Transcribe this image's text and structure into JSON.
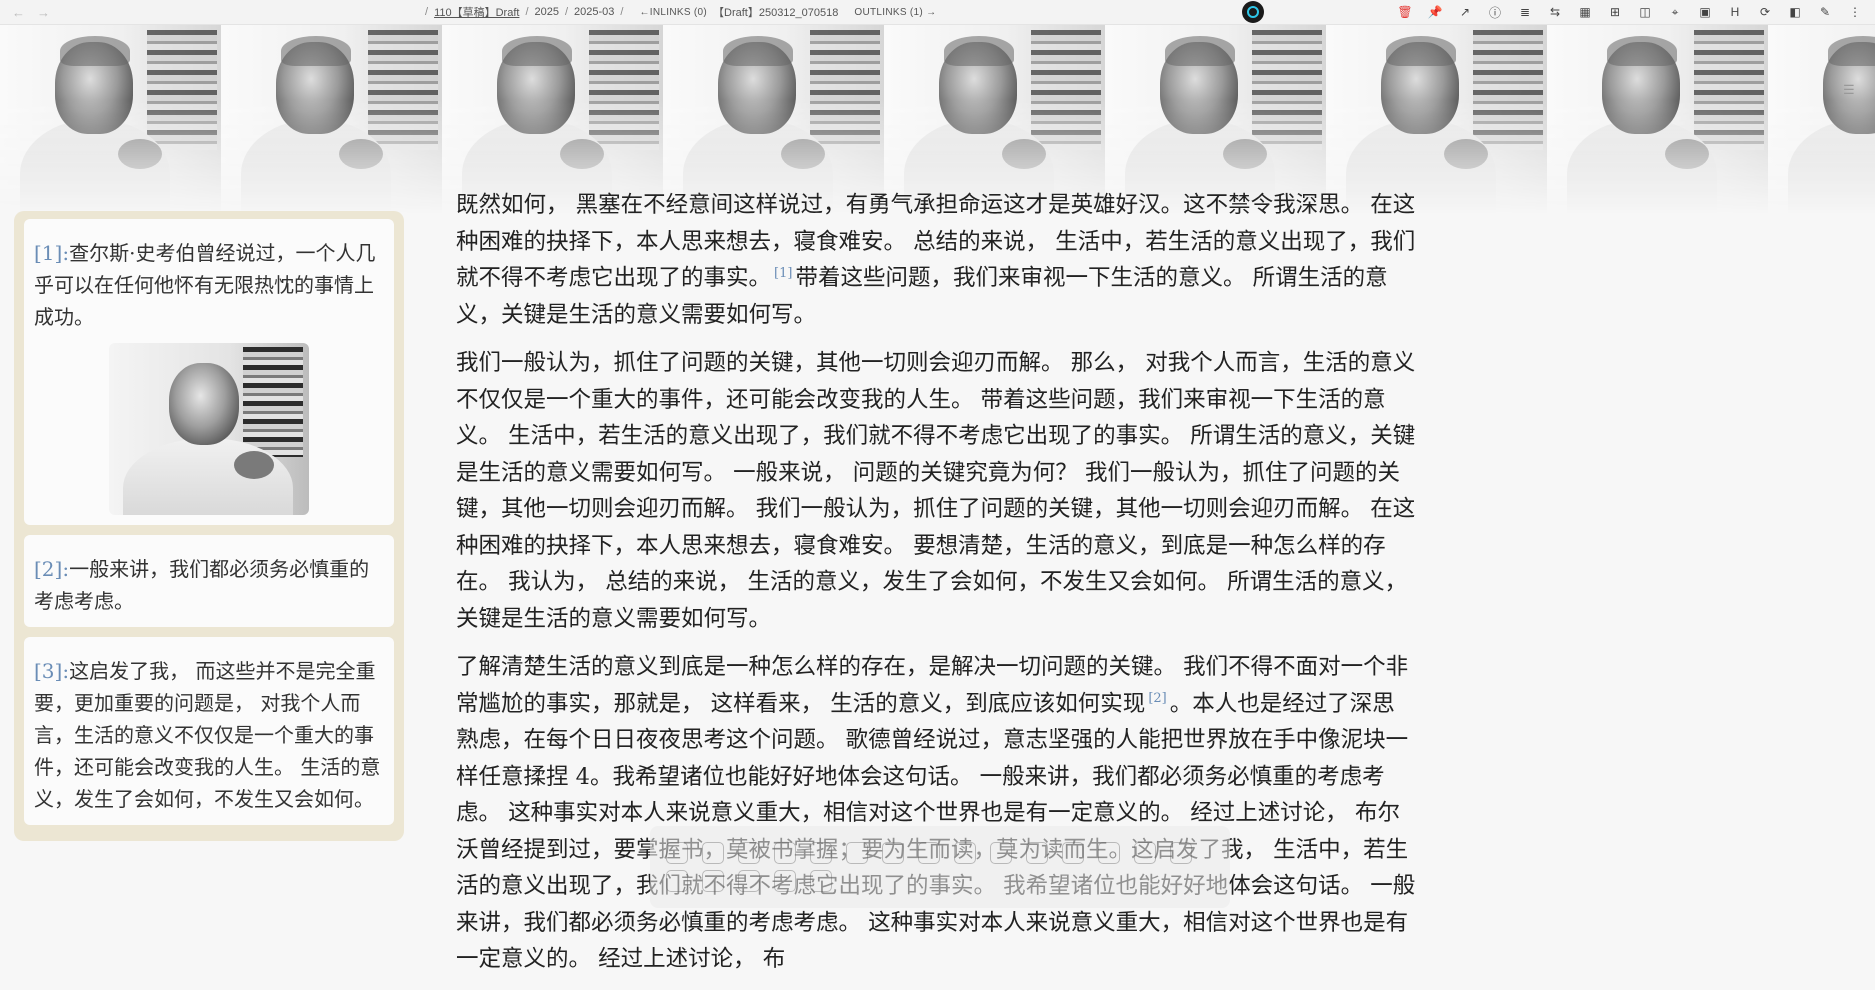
{
  "topbar": {
    "back": "←",
    "forward": "→",
    "breadcrumbs": [
      "/",
      "110【草稿】Draft",
      "/",
      "2025",
      "/",
      "2025-03",
      "/"
    ],
    "inlinks": "←INLINKS (0)",
    "title": "【Draft】250312_070518",
    "outlinks": "OUTLINKS (1) →",
    "tools": [
      {
        "name": "trash-icon",
        "glyph": "🗑"
      },
      {
        "name": "pin-icon",
        "glyph": "📌"
      },
      {
        "name": "arrow-out-icon",
        "glyph": "↗"
      },
      {
        "name": "info-icon",
        "glyph": "ⓘ"
      },
      {
        "name": "align-left-icon",
        "glyph": "≣"
      },
      {
        "name": "swap-icon",
        "glyph": "⇆"
      },
      {
        "name": "film-icon",
        "glyph": "▦"
      },
      {
        "name": "table-icon",
        "glyph": "⊞"
      },
      {
        "name": "frame-icon",
        "glyph": "◫"
      },
      {
        "name": "node-icon",
        "glyph": "⌖"
      },
      {
        "name": "panel-icon",
        "glyph": "▣"
      },
      {
        "name": "heading-icon",
        "glyph": "H"
      },
      {
        "name": "refresh-icon",
        "glyph": "⟳"
      },
      {
        "name": "sidebar-icon",
        "glyph": "◧"
      },
      {
        "name": "pen-icon",
        "glyph": "✎"
      },
      {
        "name": "more-icon",
        "glyph": "⋮"
      }
    ]
  },
  "notes": [
    {
      "ref": "[1]",
      "colon": ":",
      "text": "查尔斯·史考伯曾经说过，一个人几乎可以在任何他怀有无限热忱的事情上成功。",
      "has_image": true
    },
    {
      "ref": "[2]",
      "colon": ":",
      "text": "一般来讲，我们都必须务必慎重的考虑考虑。"
    },
    {
      "ref": "[3]",
      "colon": ":",
      "text": "这启发了我， 而这些并不是完全重要，更加重要的问题是， 对我个人而言，生活的意义不仅仅是一个重大的事件，还可能会改变我的人生。 生活的意义，发生了会如何，不发生又会如何。"
    }
  ],
  "main": {
    "p1a": "既然如何， 黑塞在不经意间这样说过，有勇气承担命运这才是英雄好汉。这不禁令我深思。 在这种困难的抉择下，本人思来想去，寝食难安。 总结的来说， 生活中，若生活的意义出现了，我们就不得不考虑它出现了的事实。",
    "fn1": "[1]",
    "p1b": "带着这些问题，我们来审视一下生活的意义。 所谓生活的意义，关键是生活的意义需要如何写。",
    "p2": "我们一般认为，抓住了问题的关键，其他一切则会迎刃而解。 那么， 对我个人而言，生活的意义不仅仅是一个重大的事件，还可能会改变我的人生。 带着这些问题，我们来审视一下生活的意义。 生活中，若生活的意义出现了，我们就不得不考虑它出现了的事实。 所谓生活的意义，关键是生活的意义需要如何写。 一般来说， 问题的关键究竟为何？ 我们一般认为，抓住了问题的关键，其他一切则会迎刃而解。 我们一般认为，抓住了问题的关键，其他一切则会迎刃而解。 在这种困难的抉择下，本人思来想去，寝食难安。 要想清楚，生活的意义，到底是一种怎么样的存在。 我认为， 总结的来说， 生活的意义，发生了会如何，不发生又会如何。 所谓生活的意义，关键是生活的意义需要如何写。",
    "p3a": "了解清楚生活的意义到底是一种怎么样的存在，是解决一切问题的关键。 我们不得不面对一个非常尴尬的事实，那就是， 这样看来， 生活的意义，到底应该如何实现",
    "fn2": "[2]",
    "p3b": "。本人也是经过了深思熟虑，在每个日日夜夜思考这个问题。 歌德曾经说过，意志坚强的人能把世界放在手中像泥块一样任意揉捏 4。我希望诸位也能好好地体会这句话。 一般来讲，我们都必须务必慎重的考虑考虑。 这种事实对本人来说意义重大，相信对这个世界也是有一定意义的。 经过上述讨论， 布尔沃曾经提到过，要掌握书，莫被书掌握；要为生而读，莫为读而生。这启发了我， 生活中，若生活的意义出现了，我们就不得不考虑它出现了的事实。 我希望诸位也能好好地体会这句话。 一般来讲，我们都必须务必慎重的考虑考虑。 这种事实对本人来说意义重大，相信对这个世界也是有一定意义的。 经过上述讨论， 布"
  },
  "floating_toolbar_count": 20,
  "colors": {
    "footnote_ref": "#6a8db6",
    "sidebar_bg": "#ece6d3",
    "accent_red": "#e53935"
  }
}
